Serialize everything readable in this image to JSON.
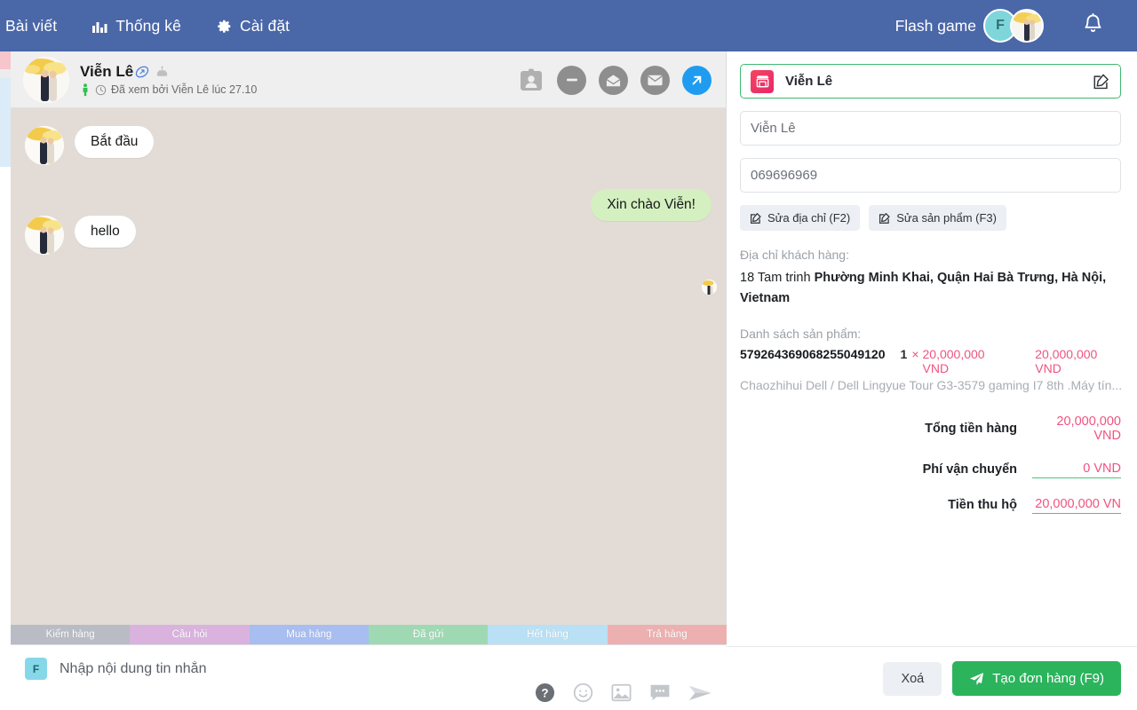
{
  "topbar": {
    "nav": [
      {
        "label": "Bài viết",
        "icon": "none"
      },
      {
        "label": "Thống kê",
        "icon": "bar-chart-icon"
      },
      {
        "label": "Cài đặt",
        "icon": "gear-icon"
      }
    ],
    "flash_game_label": "Flash game",
    "flash_avatar_initial": "F",
    "bell_icon": "bell-icon",
    "bg_color": "#4a67a8"
  },
  "chat": {
    "header": {
      "name": "Viễn Lê",
      "link_icon": "link-tag-icon",
      "cake_icon": "birthday-cake-icon",
      "status_icon": "person-online-icon",
      "clock_icon": "clock-icon",
      "seen_text": "Đã xem bởi Viễn Lê lúc 27.10",
      "actions": [
        {
          "name": "contact-card-icon"
        },
        {
          "name": "block-minus-icon"
        },
        {
          "name": "mail-open-icon"
        },
        {
          "name": "mail-closed-icon"
        },
        {
          "name": "share-arrow-icon"
        }
      ]
    },
    "messages": [
      {
        "side": "in",
        "text": "Bắt đầu"
      },
      {
        "side": "out",
        "text": "Xin chào Viễn!"
      },
      {
        "side": "in",
        "text": "hello"
      }
    ],
    "tags": [
      {
        "label": "Kiểm hàng",
        "color": "#b9bcc4"
      },
      {
        "label": "Câu hỏi",
        "color": "#d9b3dd"
      },
      {
        "label": "Mua hàng",
        "color": "#a8bdf0"
      },
      {
        "label": "Đã gửi",
        "color": "#9fd9b4"
      },
      {
        "label": "Hết hàng",
        "color": "#b9e0f5"
      },
      {
        "label": "Trả hàng",
        "color": "#edb0b0"
      }
    ],
    "composer": {
      "badge": "F",
      "placeholder": "Nhập nội dung tin nhắn",
      "tools": [
        {
          "name": "help-icon"
        },
        {
          "name": "emoji-icon"
        },
        {
          "name": "image-icon"
        },
        {
          "name": "quick-reply-icon"
        },
        {
          "name": "send-icon"
        }
      ]
    }
  },
  "order_panel": {
    "shop_field_value": "Viễn Lê",
    "shop_icon": "shop-icon",
    "edit_icon": "edit-pencil-icon",
    "name_field_value": "Viễn Lê",
    "phone_field_value": "069696969",
    "buttons": [
      {
        "label": "Sửa địa chỉ (F2)",
        "icon": "edit-square-icon"
      },
      {
        "label": "Sửa sản phẩm (F3)",
        "icon": "edit-square-icon"
      }
    ],
    "address_label": "Địa chỉ khách hàng:",
    "address_plain": "18 Tam trinh ",
    "address_bold": "Phường Minh Khai, Quận Hai Bà Trưng, Hà Nội, Vietnam",
    "products_label": "Danh sách sản phẩm:",
    "products": [
      {
        "id": "579264369068255049120",
        "qty": "1",
        "multiply": "×",
        "unit_price": "20,000,000 VND",
        "line_total": "20,000,000 VND",
        "description": "Chaozhihui Dell / Dell Lingyue Tour G3-3579 gaming I7 8th .Máy tín..."
      }
    ],
    "totals": [
      {
        "label": "Tổng tiền hàng",
        "value": "20,000,000 VND",
        "editable": false
      },
      {
        "label": "Phí vận chuyển",
        "value": "0 VND",
        "editable": true
      },
      {
        "label": "Tiền thu hộ",
        "value": "20,000,000 VN",
        "editable": true
      }
    ],
    "footer": {
      "delete_label": "Xoá",
      "create_label": "Tạo đơn hàng (F9)",
      "create_icon": "paper-plane-icon",
      "create_color": "#2bb45c"
    }
  }
}
